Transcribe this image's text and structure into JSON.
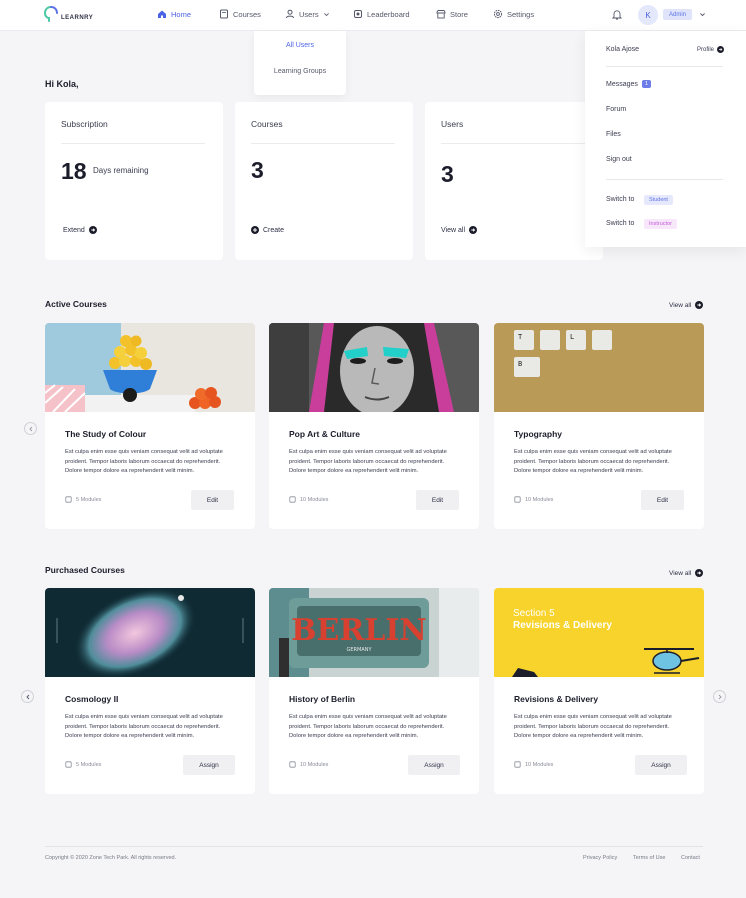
{
  "brand": {
    "name": "LEARNRY"
  },
  "nav": {
    "items": [
      {
        "label": "Home",
        "icon": "home-icon",
        "active": true
      },
      {
        "label": "Courses",
        "icon": "book-icon"
      },
      {
        "label": "Users",
        "icon": "user-icon"
      },
      {
        "label": "Leaderboard",
        "icon": "medal-icon"
      },
      {
        "label": "Store",
        "icon": "store-icon"
      },
      {
        "label": "Settings",
        "icon": "gear-icon"
      }
    ],
    "avatar_initial": "K",
    "role": "Admin"
  },
  "users_menu": {
    "items": [
      "All Users",
      "Learning Groups"
    ]
  },
  "profile_menu": {
    "name": "Kola Ajose",
    "profile_label": "Profile",
    "messages_label": "Messages",
    "messages_count": "1",
    "forum_label": "Forum",
    "files_label": "Files",
    "signout_label": "Sign out",
    "switch_label": "Switch to",
    "student_label": "Student",
    "instructor_label": "Instructor"
  },
  "greeting": "Hi Kola,",
  "stats": [
    {
      "title": "Subscription",
      "value": "18",
      "sub": "Days remaining",
      "link": "Extend"
    },
    {
      "title": "Courses",
      "value": "3",
      "link": "Create"
    },
    {
      "title": "Users",
      "value": "3",
      "link": "View all"
    }
  ],
  "active_courses": {
    "title": "Active Courses",
    "view_all": "View all",
    "items": [
      {
        "title": "The Study of Colour",
        "desc": "Est culpa enim esse quis veniam consequat velit ad voluptate proident. Tempor laboris laborum occaecat do reprehenderit. Dolore tempor dolore ea reprehenderit velit minim.",
        "modules": "5 Modules",
        "action": "Edit"
      },
      {
        "title": "Pop Art & Culture",
        "desc": "Est culpa enim esse quis veniam consequat velit ad voluptate proident. Tempor laboris laborum occaecat do reprehenderit. Dolore tempor dolore ea reprehenderit velit minim.",
        "modules": "10 Modules",
        "action": "Edit"
      },
      {
        "title": "Typography",
        "desc": "Est culpa enim esse quis veniam consequat velit ad voluptate proident. Tempor laboris laborum occaecat do reprehenderit. Dolore tempor dolore ea reprehenderit velit minim.",
        "modules": "10 Modules",
        "action": "Edit"
      }
    ]
  },
  "purchased_courses": {
    "title": "Purchased Courses",
    "view_all": "View all",
    "items": [
      {
        "title": "Cosmology II",
        "desc": "Est culpa enim esse quis veniam consequat velit ad voluptate proident. Tempor laboris laborum occaecat do reprehenderit. Dolore tempor dolore ea reprehenderit velit minim.",
        "modules": "5 Modules",
        "action": "Assign"
      },
      {
        "title": "History of Berlin",
        "desc": "Est culpa enim esse quis veniam consequat velit ad voluptate proident. Tempor laboris laborum occaecat do reprehenderit. Dolore tempor dolore ea reprehenderit velit minim.",
        "modules": "10 Modules",
        "action": "Assign"
      },
      {
        "title": "Revisions & Delivery",
        "desc": "Est culpa enim esse quis veniam consequat velit ad voluptate proident. Tempor laboris laborum occaecat do reprehenderit. Dolore tempor dolore ea reprehenderit velit minim.",
        "modules": "10 Modules",
        "action": "Assign"
      }
    ]
  },
  "images": {
    "typography_keys": [
      "T",
      "",
      "L",
      "",
      "B"
    ],
    "berlin_sign": "BERLIN",
    "berlin_sub": "GERMANY",
    "revisions_line1": "Section 5",
    "revisions_line2": "Revisions & Delivery"
  },
  "footer": {
    "copyright": "Copyright © 2020 Zone Tech Park. All rights reserved.",
    "links": [
      "Privacy Policy",
      "Terms of Use",
      "Contact"
    ]
  },
  "colors": {
    "accent": "#4c63e6",
    "yellow": "#f7d32b",
    "page_bg": "#f5f5f7"
  }
}
